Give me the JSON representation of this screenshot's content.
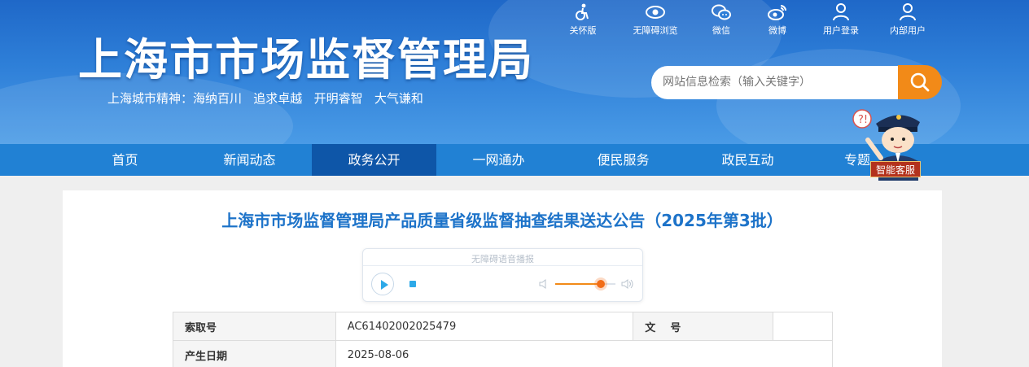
{
  "header": {
    "site_title": "上海市市场监督管理局",
    "motto": "上海城市精神：海纳百川   追求卓越   开明睿智   大气谦和",
    "top_links": [
      {
        "label": "关怀版",
        "icon": "care-accessibility-icon"
      },
      {
        "label": "无障碍浏览",
        "icon": "eye-icon"
      },
      {
        "label": "微信",
        "icon": "wechat-icon"
      },
      {
        "label": "微博",
        "icon": "weibo-icon"
      },
      {
        "label": "用户登录",
        "icon": "user-icon"
      },
      {
        "label": "内部用户",
        "icon": "user-icon"
      }
    ],
    "search": {
      "placeholder": "网站信息检索（输入关键字）",
      "button_icon": "search-icon"
    },
    "assistant_label": "智能客服"
  },
  "nav": {
    "items": [
      {
        "label": "首页"
      },
      {
        "label": "新闻动态"
      },
      {
        "label": "政务公开",
        "active": true
      },
      {
        "label": "一网通办"
      },
      {
        "label": "便民服务"
      },
      {
        "label": "政民互动"
      },
      {
        "label": "专题"
      }
    ]
  },
  "article": {
    "title": "上海市市场监督管理局产品质量省级监督抽查结果送达公告（2025年第3批）",
    "player": {
      "title": "无障碍语音播报",
      "volume_percent": 75
    },
    "meta": {
      "index_label": "索取号",
      "index_value": "AC61402002025479",
      "doc_no_label": "文    号",
      "doc_no_value": "",
      "date_label": "产生日期",
      "date_value": "2025-08-06"
    }
  },
  "colors": {
    "header_blue": "#2e7fd8",
    "nav_blue": "#2181d4",
    "nav_active": "#0e56a8",
    "title_blue": "#1d73c9",
    "accent_orange": "#f28a18"
  }
}
